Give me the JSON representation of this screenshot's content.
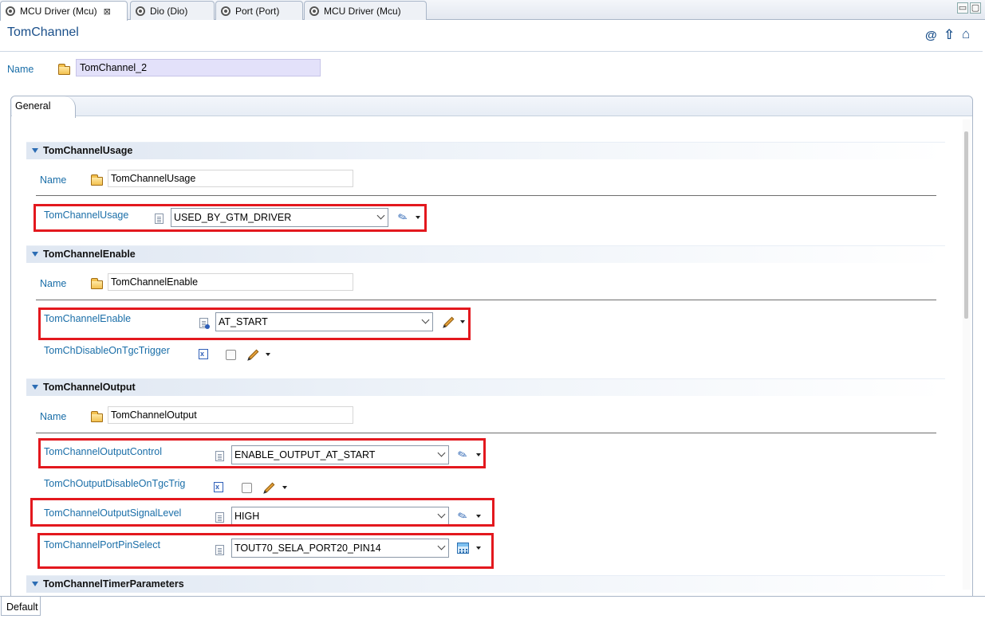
{
  "editor_tabs": [
    {
      "label": "MCU Driver (Mcu)",
      "close": "⊠"
    },
    {
      "label": "Dio (Dio)"
    },
    {
      "label": "Port (Port)"
    },
    {
      "label": "MCU Driver (Mcu)"
    }
  ],
  "window_buttons": {
    "minimize": "▭",
    "maximize": "▢"
  },
  "header": {
    "title": "TomChannel",
    "icons": {
      "at": "@",
      "up": "⇧",
      "home": "⌂"
    }
  },
  "name_row": {
    "label": "Name",
    "value": "TomChannel_2"
  },
  "general_tab": {
    "label": "General"
  },
  "sections": {
    "usage": {
      "title": "TomChannelUsage",
      "name_label": "Name",
      "name_value": "TomChannelUsage",
      "field_label": "TomChannelUsage",
      "field_value": "USED_BY_GTM_DRIVER"
    },
    "enable": {
      "title": "TomChannelEnable",
      "name_label": "Name",
      "name_value": "TomChannelEnable",
      "field_label": "TomChannelEnable",
      "field_value": "AT_START",
      "trigger_label": "TomChDisableOnTgcTrigger"
    },
    "output": {
      "title": "TomChannelOutput",
      "name_label": "Name",
      "name_value": "TomChannelOutput",
      "control_label": "TomChannelOutputControl",
      "control_value": "ENABLE_OUTPUT_AT_START",
      "disable_label": "TomChOutputDisableOnTgcTrig",
      "signal_label": "TomChannelOutputSignalLevel",
      "signal_value": "HIGH",
      "pin_label": "TomChannelPortPinSelect",
      "pin_value": "TOUT70_SELA_PORT20_PIN14"
    },
    "timer": {
      "title": "TomChannelTimerParameters"
    }
  },
  "bottom_tab": {
    "label": "Default"
  },
  "colors": {
    "highlight": "#e3181e",
    "label": "#1a6ea8",
    "title": "#1a4f8a"
  }
}
